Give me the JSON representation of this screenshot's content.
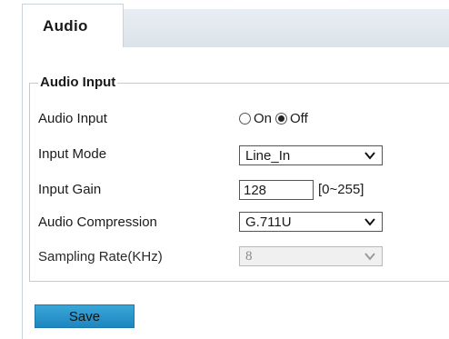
{
  "tabs": [
    {
      "label": "Audio"
    }
  ],
  "section": {
    "title": "Audio Input"
  },
  "fields": {
    "audio_input": {
      "label": "Audio Input",
      "options": [
        {
          "label": "On",
          "checked": false
        },
        {
          "label": "Off",
          "checked": true
        }
      ]
    },
    "input_mode": {
      "label": "Input Mode",
      "value": "Line_In"
    },
    "input_gain": {
      "label": "Input Gain",
      "value": "128",
      "range": "[0~255]"
    },
    "audio_compression": {
      "label": "Audio Compression",
      "value": "G.711U"
    },
    "sampling_rate": {
      "label": "Sampling Rate(KHz)",
      "value": "8",
      "disabled": true
    }
  },
  "actions": {
    "save_label": "Save"
  },
  "colors": {
    "accent": "#2a9bd1",
    "tab_strip": "#dfe6ec"
  }
}
